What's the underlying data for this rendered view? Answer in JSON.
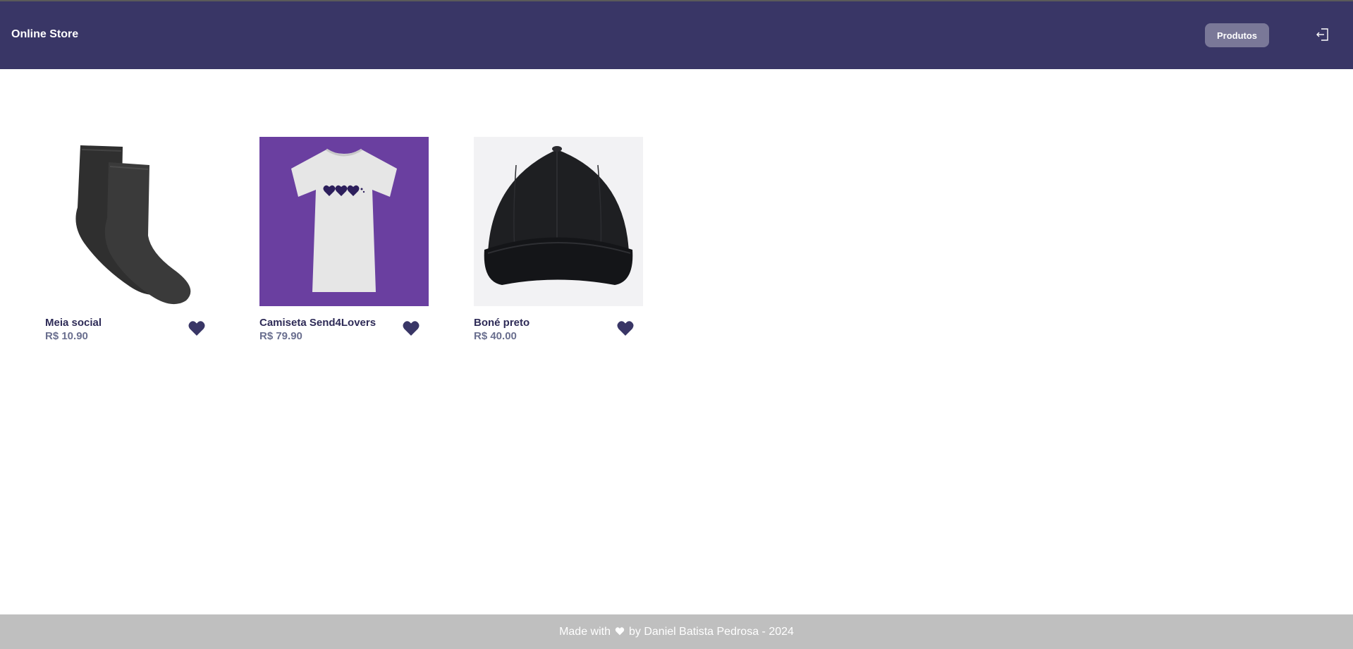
{
  "header": {
    "brand": "Online Store",
    "nav_button": "Produtos",
    "logout_icon": "logout-icon"
  },
  "products": [
    {
      "name": "Meia social",
      "price": "R$ 10.90",
      "image": "socks-image",
      "fav_icon": "heart-icon"
    },
    {
      "name": "Camiseta Send4Lovers",
      "price": "R$ 79.90",
      "image": "tshirt-image",
      "fav_icon": "heart-icon"
    },
    {
      "name": "Boné preto",
      "price": "R$ 40.00",
      "image": "cap-image",
      "fav_icon": "heart-icon"
    }
  ],
  "footer": {
    "prefix": "Made with",
    "suffix": "by Daniel Batista Pedrosa - 2024",
    "icon": "heart-icon"
  },
  "colors": {
    "header_bg": "#393666",
    "accent": "#393666",
    "footer_bg": "#bfbfbf",
    "button_bg": "#7a7898",
    "tshirt_bg": "#6a3fa0"
  }
}
